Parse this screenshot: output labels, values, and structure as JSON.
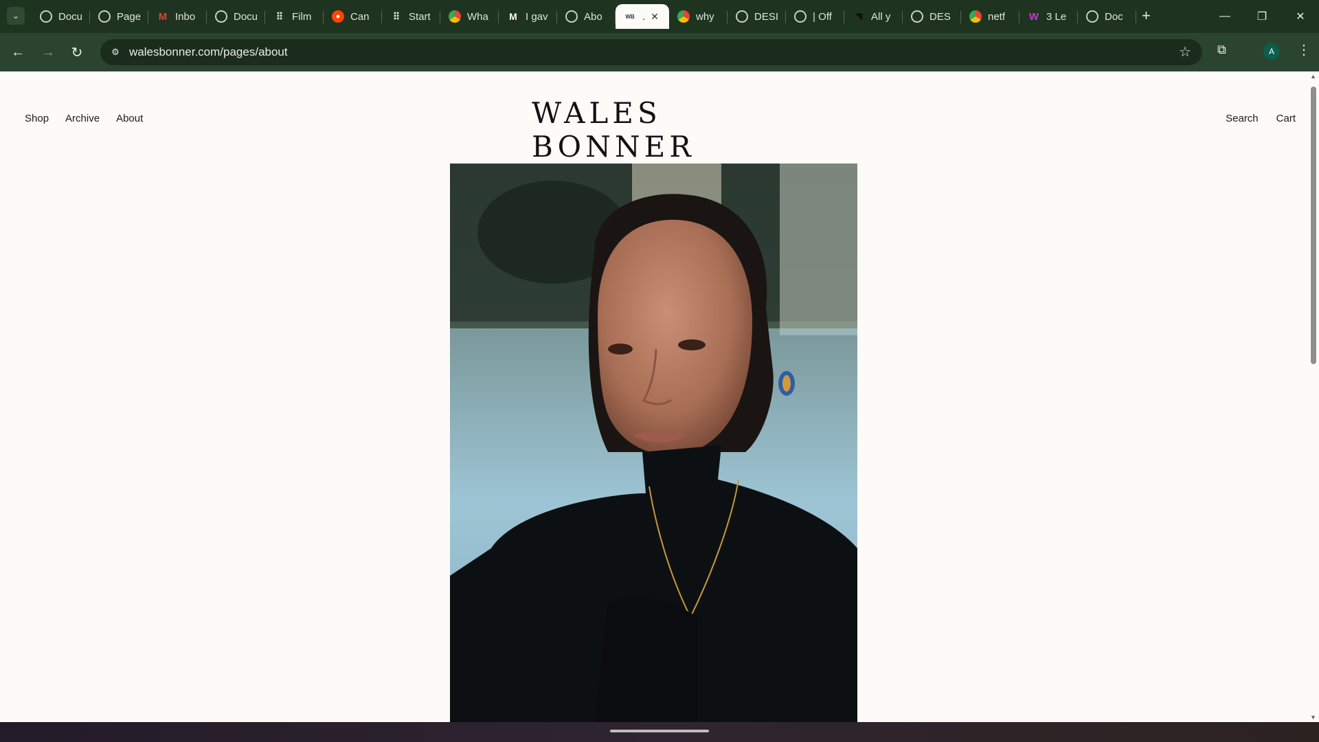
{
  "browser": {
    "tabs": [
      {
        "label": "Docu",
        "icon": "globe"
      },
      {
        "label": "Page",
        "icon": "globe"
      },
      {
        "label": "Inbo",
        "icon": "gmail"
      },
      {
        "label": "Docu",
        "icon": "globe"
      },
      {
        "label": "Film",
        "icon": "grid"
      },
      {
        "label": "Can",
        "icon": "reddit"
      },
      {
        "label": "Start",
        "icon": "grid"
      },
      {
        "label": "Wha",
        "icon": "chrome"
      },
      {
        "label": "I gav",
        "icon": "medium"
      },
      {
        "label": "Abo",
        "icon": "globe"
      },
      {
        "label": ".",
        "icon": "wb",
        "active": true
      },
      {
        "label": "why",
        "icon": "chrome"
      },
      {
        "label": "DESI",
        "icon": "globe"
      },
      {
        "label": "| Off",
        "icon": "globe"
      },
      {
        "label": "All y",
        "icon": "flag"
      },
      {
        "label": "DES",
        "icon": "globe"
      },
      {
        "label": "netf",
        "icon": "chrome"
      },
      {
        "label": "3 Le",
        "icon": "w3"
      },
      {
        "label": "Doc",
        "icon": "globe"
      }
    ],
    "url": "walesbonner.com/pages/about",
    "profile_initial": "A"
  },
  "site": {
    "logo": "WALES BONNER",
    "nav_left": [
      "Shop",
      "Archive",
      "About"
    ],
    "nav_right": [
      "Search",
      "Cart"
    ]
  },
  "colors": {
    "tabstrip": "#1f3321",
    "toolbar": "#2b4430",
    "page_bg": "#fcfbf8"
  }
}
